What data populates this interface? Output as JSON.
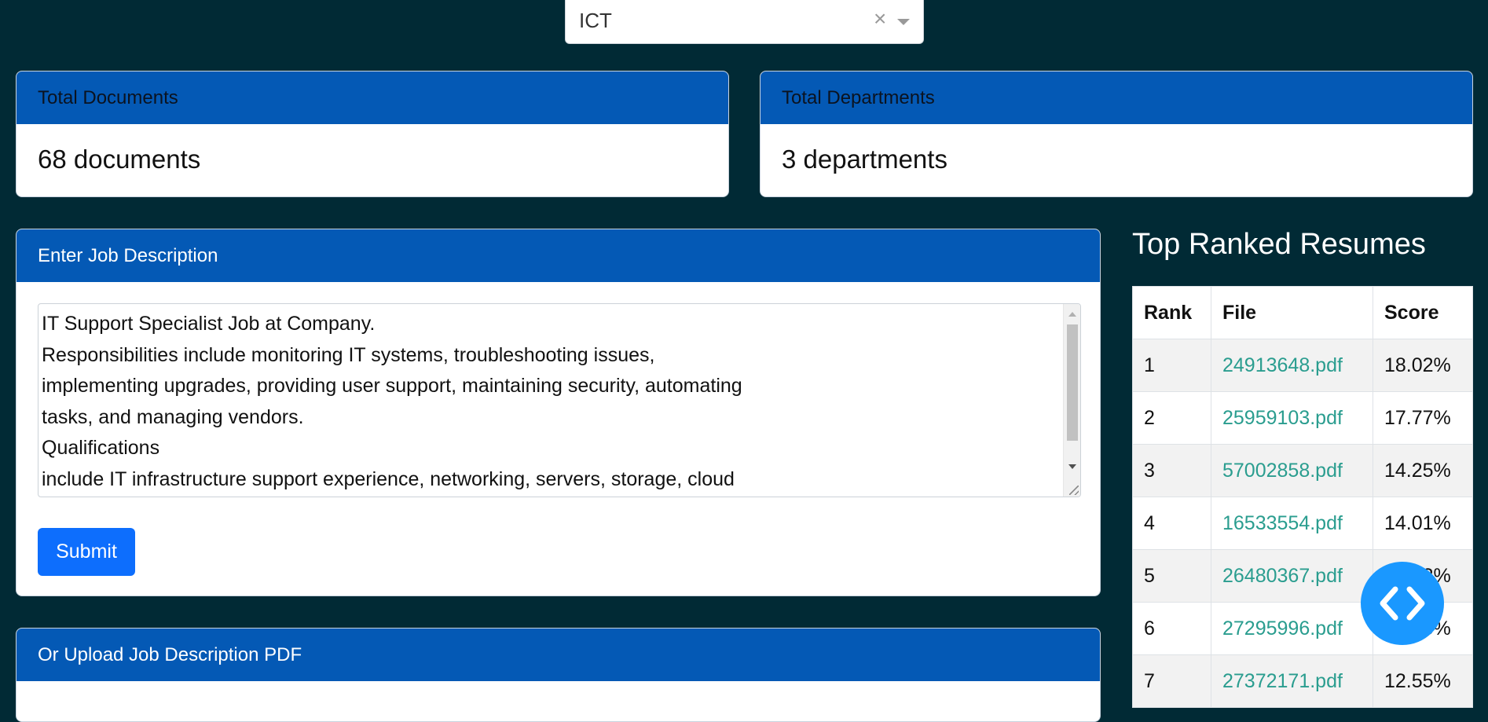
{
  "department_select": {
    "value": "ICT",
    "clear_symbol": "×"
  },
  "stats": {
    "documents": {
      "label": "Total Documents",
      "value": "68 documents"
    },
    "departments": {
      "label": "Total Departments",
      "value": "3 departments"
    }
  },
  "job_description": {
    "header": "Enter Job Description",
    "text": "IT Support Specialist Job at Company.\nResponsibilities include monitoring IT systems, troubleshooting issues,\nimplementing upgrades, providing user support, maintaining security, automating\ntasks, and managing vendors.\nQualifications\ninclude IT infrastructure support experience, networking, servers, storage, cloud",
    "submit_label": "Submit"
  },
  "upload": {
    "header": "Or Upload Job Description PDF"
  },
  "ranked": {
    "title": "Top Ranked Resumes",
    "columns": [
      "Rank",
      "File",
      "Score"
    ],
    "rows": [
      {
        "rank": "1",
        "file": "24913648.pdf",
        "score": "18.02%"
      },
      {
        "rank": "2",
        "file": "25959103.pdf",
        "score": "17.77%"
      },
      {
        "rank": "3",
        "file": "57002858.pdf",
        "score": "14.25%"
      },
      {
        "rank": "4",
        "file": "16533554.pdf",
        "score": "14.01%"
      },
      {
        "rank": "5",
        "file": "26480367.pdf",
        "score": "13.82%"
      },
      {
        "rank": "6",
        "file": "27295996.pdf",
        "score": "13.05%"
      },
      {
        "rank": "7",
        "file": "27372171.pdf",
        "score": "12.55%"
      }
    ]
  },
  "icons": {
    "fab": "code-brackets-icon"
  },
  "colors": {
    "background": "#012a35",
    "card_header": "#0459b5",
    "primary_button": "#0d6efd",
    "link": "#2a9d8f",
    "fab": "#1a98ff"
  }
}
